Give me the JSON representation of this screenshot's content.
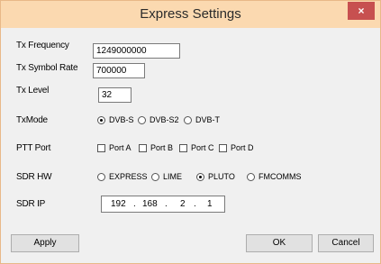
{
  "window": {
    "title": "Express Settings",
    "close_glyph": "×"
  },
  "fields": {
    "tx_frequency": {
      "label": "Tx Frequency",
      "value": "1249000000"
    },
    "tx_symbol_rate": {
      "label": "Tx Symbol Rate",
      "value": "700000"
    },
    "tx_level": {
      "label": "Tx Level",
      "value": "32"
    }
  },
  "tx_mode": {
    "label": "TxMode",
    "options": [
      "DVB-S",
      "DVB-S2",
      "DVB-T"
    ],
    "selected": "DVB-S"
  },
  "ptt_port": {
    "label": "PTT Port",
    "options": [
      "Port A",
      "Port B",
      "Port C",
      "Port D"
    ]
  },
  "sdr_hw": {
    "label": "SDR HW",
    "options": [
      "EXPRESS",
      "LIME",
      "PLUTO",
      "FMCOMMS"
    ],
    "selected": "PLUTO"
  },
  "sdr_ip": {
    "label": "SDR IP",
    "octets": [
      "192",
      "168",
      "2",
      "1"
    ],
    "dot": "."
  },
  "buttons": {
    "apply": "Apply",
    "ok": "OK",
    "cancel": "Cancel"
  }
}
